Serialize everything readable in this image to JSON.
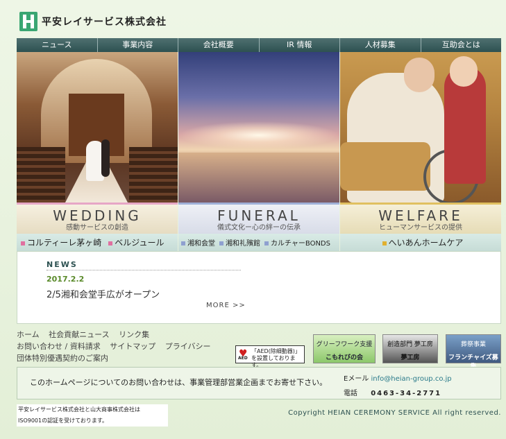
{
  "header": {
    "company_name": "平安レイサービス株式会社",
    "logo_icon": "heian-logo-icon"
  },
  "nav": [
    "ニュース",
    "事業内容",
    "会社概要",
    "IR 情報",
    "人材募集",
    "互助会とは"
  ],
  "panels": [
    {
      "title": "WEDDING",
      "subtitle": "感動サービスの創造",
      "accent": "#e6a6c6",
      "links": [
        "コルティーレ茅ヶ崎",
        "ベルジュール"
      ],
      "link_color": "#e070a0"
    },
    {
      "title": "FUNERAL",
      "subtitle": "儀式文化ー心の絆ーの伝承",
      "accent": "#9fb0d8",
      "links": [
        "湘和会堂",
        "湘和礼殯館",
        "カルチャーBONDS"
      ],
      "link_color": "#8fa0d0"
    },
    {
      "title": "WELFARE",
      "subtitle": "ヒューマンサービスの提供",
      "accent": "#e0c060",
      "links": [
        "へいあんホームケア"
      ],
      "link_color": "#e0b030"
    }
  ],
  "news": {
    "title": "NEWS",
    "date": "2017.2.2",
    "item": "2/5湘和会堂手広がオープン",
    "more": "MORE >>"
  },
  "footer_links": {
    "row1": [
      "ホーム",
      "社会貢献ニュース",
      "リンク集"
    ],
    "row2": [
      "お問い合わせ / 資料請求",
      "サイトマップ",
      "プライバシー"
    ],
    "row3": [
      "団体特別優遇契約のご案内"
    ]
  },
  "aed": {
    "text": "「AED(除細動器)」を設置しております。",
    "tag": "AED"
  },
  "banners": [
    {
      "line1": "グリーフワーク支援",
      "line2": "こもれびの会"
    },
    {
      "line1": "創造部門 夢工房",
      "line2": "夢工房"
    },
    {
      "line1": "葬祭事業",
      "line2": "フランチャイズ募集"
    }
  ],
  "contact": {
    "text": "このホームページについてのお問い合わせは、事業管理部営業企画までお寄せ下さい。",
    "email_label": "Eメール",
    "email": "info@heian-group.co.jp",
    "tel_label": "電話",
    "tel": "0463-34-2771"
  },
  "iso": {
    "line1": "平安レイサービス株式会社と山大商事株式会社は",
    "line2": "ISO9001の認証を受けております。"
  },
  "copyright": "Copyright HEIAN CEREMONY SERVICE All right reserved."
}
